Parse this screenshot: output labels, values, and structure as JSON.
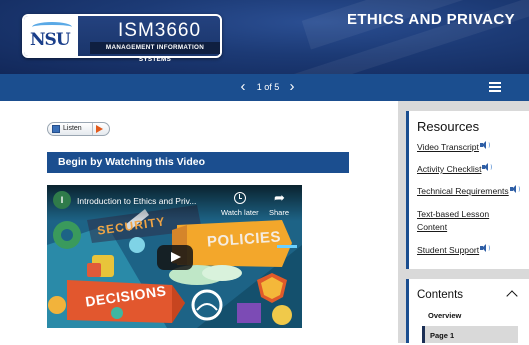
{
  "header": {
    "logo_text": "NSU",
    "course_code": "ISM3660",
    "course_name": "MANAGEMENT INFORMATION SYSTEMS",
    "page_title": "ETHICS AND PRIVACY"
  },
  "nav": {
    "prev_icon": "chevron-left-icon",
    "next_icon": "chevron-right-icon",
    "page_indicator": "1 of 5",
    "menu_icon": "hamburger-menu-icon"
  },
  "listen": {
    "label": "Listen"
  },
  "main": {
    "section_heading": "Begin by Watching this Video",
    "video": {
      "channel_initial": "I",
      "title": "Introduction to Ethics and Priv...",
      "watch_later_label": "Watch later",
      "share_label": "Share",
      "thumbnail_words": [
        "SECURITY",
        "POLICIES",
        "DECISIONS"
      ]
    }
  },
  "sidebar": {
    "resources": {
      "title": "Resources",
      "links": [
        {
          "line1": "Video Transcript",
          "line2": "",
          "audio": true
        },
        {
          "line1": "Activity Checklist",
          "line2": "",
          "audio": true
        },
        {
          "line1": "Technical Requirements",
          "line2": "",
          "audio": true
        },
        {
          "line1": "Text-based Lesson",
          "line2": "Content",
          "audio": false
        },
        {
          "line1": "Student Support",
          "line2": "",
          "audio": true
        }
      ]
    },
    "contents": {
      "title": "Contents",
      "items": [
        "Overview",
        "Page 1"
      ]
    }
  },
  "colors": {
    "brand_blue": "#1b4e8f",
    "header_dark": "#12285a",
    "sidebar_gray": "#d9d9d9",
    "listen_accent": "#e25a1c"
  }
}
